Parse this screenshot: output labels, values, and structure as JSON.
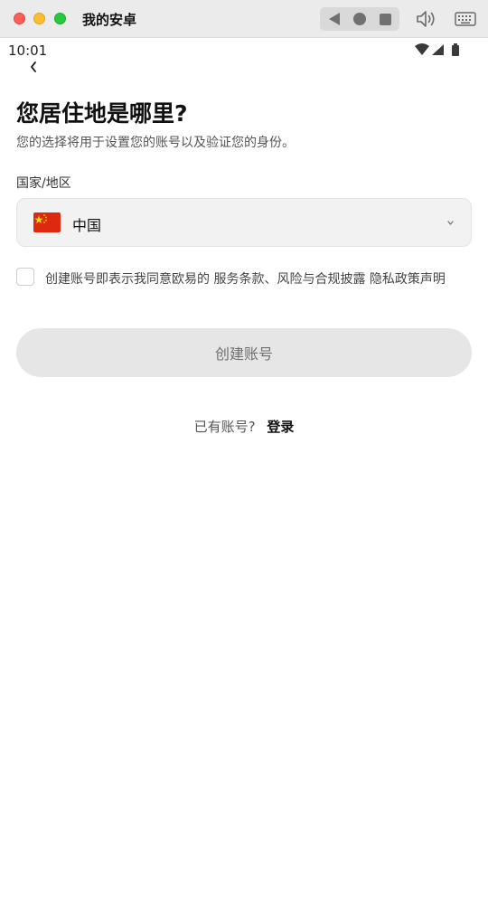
{
  "window": {
    "title": "我的安卓",
    "icons": [
      "close-dot",
      "minimize-dot",
      "zoom-dot",
      "back-triangle-icon",
      "home-circle-icon",
      "recents-square-icon",
      "speaker-icon",
      "keyboard-icon"
    ]
  },
  "status_bar": {
    "time": "10:01",
    "icons": [
      "wifi-icon",
      "cell-signal-icon",
      "battery-icon"
    ]
  },
  "page": {
    "heading": "您居住地是哪里?",
    "subheading": "您的选择将用于设置您的账号以及验证您的身份。",
    "region_label": "国家/地区",
    "country": {
      "value": "中国",
      "flag": "china-flag-icon"
    },
    "agreement": {
      "prefix": "创建账号即表示我同意欧易的",
      "terms_link": "服务条款、风险与合规披露",
      "privacy_link": "隐私政策声明",
      "checked": false
    },
    "create_button": "创建账号",
    "login_prompt": "已有账号?",
    "login_link": "登录"
  },
  "colors": {
    "titlebar_bg": "#ebebeb",
    "select_bg": "#f2f2f2",
    "button_bg": "#e6e6e6",
    "button_text": "#6f6f6f",
    "flag_red": "#de2910",
    "flag_yellow": "#ffde00"
  }
}
